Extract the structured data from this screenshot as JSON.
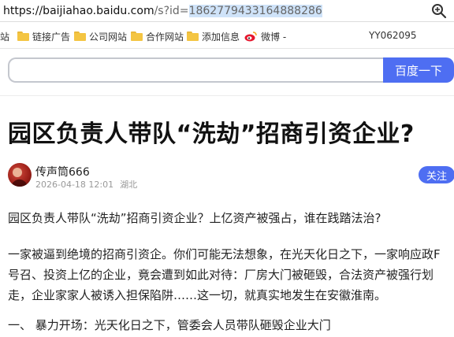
{
  "browser": {
    "url_host": "https://baijiahao.baidu.com",
    "url_path": "/s?id=",
    "url_query": "1862779433164888286",
    "zoom_icon": "zoom-magnifier-icon"
  },
  "bookmarks": [
    {
      "label": "站",
      "icon": "none"
    },
    {
      "label": "链接广告",
      "icon": "folder-icon"
    },
    {
      "label": "公司网站",
      "icon": "folder-icon"
    },
    {
      "label": "合作网站",
      "icon": "folder-icon"
    },
    {
      "label": "添加信息",
      "icon": "folder-icon"
    },
    {
      "label": "微博 -",
      "icon": "weibo-icon"
    }
  ],
  "bookmarks_user": "YY062095",
  "search": {
    "placeholder": "",
    "button_label": "百度一下",
    "accent": "#4e6ef2"
  },
  "article": {
    "title": "园区负责人带队“洗劫”招商引资企业?",
    "author": "传声筒666",
    "date": "2026-04-18 12:01",
    "location": "湖北",
    "follow_label": "关注",
    "para1": "园区负责人带队“洗劫”招商引资企业？上亿资产被强占，谁在践踏法治?",
    "para2_lines": [
      "一家被逼到绝境的招商引资企。你们可能无法想象，在光天化日之下，一家响应政F",
      "号召、投资上亿的企业，竟会遭到如此对待：厂房大门被砸毁，合法资产被强行划",
      "走，企业家家人被诱入担保陷阱……这一切，就真实地发生在安徽淮南。"
    ],
    "heading1": "一、 暴力开场：光天化日之下，管委会人员带队砸毁企业大门"
  }
}
